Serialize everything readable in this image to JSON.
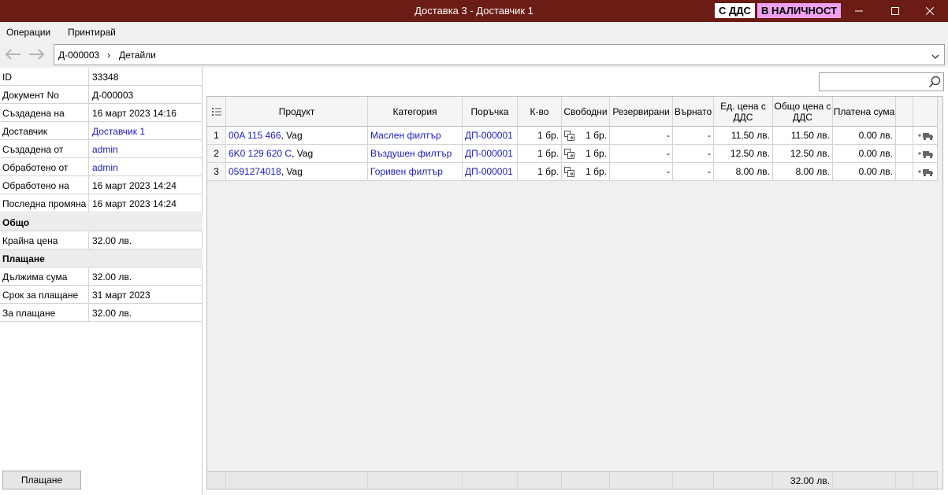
{
  "window": {
    "title": "Доставка 3 - Доставчик 1",
    "badge_vat": "С ДДС",
    "badge_stock": "В НАЛИЧНОСТ"
  },
  "menu": {
    "operations": "Операции",
    "print": "Принтирай"
  },
  "breadcrumb": {
    "doc": "Д-000003",
    "separator": "›",
    "page": "Детайли"
  },
  "info": [
    {
      "label": "ID",
      "value": "33348",
      "link": false
    },
    {
      "label": "Документ No",
      "value": "Д-000003",
      "link": false
    },
    {
      "label": "Създадена на",
      "value": "16 март 2023 14:16",
      "link": false
    },
    {
      "label": "Доставчик",
      "value": "Доставчик 1",
      "link": true
    },
    {
      "label": "Създадена от",
      "value": "admin",
      "link": true
    },
    {
      "label": "Обработено от",
      "value": "admin",
      "link": true
    },
    {
      "label": "Обработено на",
      "value": "16 март 2023 14:24",
      "link": false
    },
    {
      "label": "Последна промяна",
      "value": "16 март 2023 14:24",
      "link": false
    }
  ],
  "total_section": {
    "heading": "Общо",
    "label": "Крайна цена",
    "value": "32.00 лв."
  },
  "payment_section": {
    "heading": "Плащане",
    "rows": [
      {
        "label": "Дължима сума",
        "value": "32.00 лв."
      },
      {
        "label": "Срок за плащане",
        "value": "31 март 2023"
      },
      {
        "label": "За плащане",
        "value": "32.00 лв."
      }
    ]
  },
  "pay_button": "Плащане",
  "table": {
    "headers": {
      "product": "Продукт",
      "category": "Категория",
      "order": "Поръчка",
      "qty": "К-во",
      "free": "Свободни",
      "reserved": "Резервирани",
      "returned": "Върнато",
      "unit_price": "Ед. цена с ДДС",
      "total_price": "Общо цена с ДДС",
      "paid": "Платена сума"
    },
    "rows": [
      {
        "n": "1",
        "product_code": "00A 115 466",
        "brand": ", Vag",
        "category": "Маслен филтър",
        "order": "ДП-000001",
        "qty": "1 бр.",
        "free": "1 бр.",
        "reserved": "-",
        "returned": "-",
        "unit_price": "11.50 лв.",
        "total_price": "11.50 лв.",
        "paid": "0.00 лв."
      },
      {
        "n": "2",
        "product_code": "6K0 129 620 C",
        "brand": ", Vag",
        "category": "Въздушен филтър",
        "order": "ДП-000001",
        "qty": "1 бр.",
        "free": "1 бр.",
        "reserved": "-",
        "returned": "-",
        "unit_price": "12.50 лв.",
        "total_price": "12.50 лв.",
        "paid": "0.00 лв."
      },
      {
        "n": "3",
        "product_code": "0591274018",
        "brand": ", Vag",
        "category": "Горивен филтър",
        "order": "ДП-000001",
        "qty": "1 бр.",
        "free": "1 бр.",
        "reserved": "-",
        "returned": "-",
        "unit_price": "8.00 лв.",
        "total_price": "8.00 лв.",
        "paid": "0.00 лв."
      }
    ],
    "footer_total": "32.00 лв."
  }
}
